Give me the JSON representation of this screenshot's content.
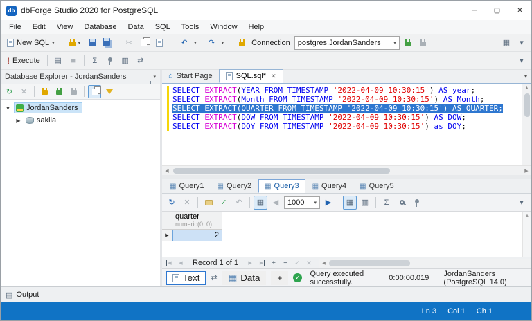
{
  "colors": {
    "accent": "#1073c5",
    "selection": "#2e77d0",
    "keyword": "#0000f0",
    "function": "#d600d6",
    "string": "#e00000",
    "changebar": "#f5d60a",
    "success": "#2ea44f"
  },
  "icons": {
    "minimize": "─",
    "maximize": "▢",
    "close": "✕",
    "caret_down": "▾",
    "overflow": "▾",
    "refresh": "↻",
    "undo": "↶",
    "redo": "↷",
    "cut": "✂",
    "check": "✓",
    "cross": "✕",
    "play_right": "▶",
    "play_left": "◀",
    "tri_up": "▲",
    "tri_down": "▼",
    "grid": "▦",
    "card": "▥",
    "swap": "⇄",
    "home": "⌂",
    "row_marker": "▶",
    "plus": "+",
    "minus": "−",
    "stop": "■",
    "sigma": "Σ",
    "panel": "▤",
    "exclaim": "!",
    "logo_text": "db"
  },
  "window": {
    "title": "dbForge Studio 2020 for PostgreSQL"
  },
  "menu": {
    "items": [
      "File",
      "Edit",
      "View",
      "Database",
      "Data",
      "SQL",
      "Tools",
      "Window",
      "Help"
    ]
  },
  "toolbar_standard": {
    "new_sql_label": "New SQL",
    "connection_label": "Connection",
    "connection_value": "postgres.JordanSanders"
  },
  "toolbar_execute": {
    "execute_label": "Execute"
  },
  "explorer": {
    "title": "Database Explorer - JordanSanders",
    "nodes": [
      {
        "label": "JordanSanders"
      },
      {
        "label": "sakila"
      }
    ]
  },
  "doc_tabs": {
    "start_page": "Start Page",
    "sql_doc": "SQL.sql*"
  },
  "editor": {
    "lines": [
      {
        "selected": false,
        "tokens": [
          {
            "t": "SELECT ",
            "c": "kw"
          },
          {
            "t": "EXTRACT",
            "c": "fn"
          },
          {
            "t": "(",
            "c": "pl"
          },
          {
            "t": "YEAR",
            "c": "kw"
          },
          {
            "t": " FROM TIMESTAMP ",
            "c": "kw"
          },
          {
            "t": "'2022-04-09 10:30:15'",
            "c": "str"
          },
          {
            "t": ")",
            "c": "pl"
          },
          {
            "t": " ",
            "c": "pl"
          },
          {
            "t": "AS",
            "c": "kw"
          },
          {
            "t": " ",
            "c": "pl"
          },
          {
            "t": "year",
            "c": "kw"
          },
          {
            "t": ";",
            "c": "pl"
          }
        ]
      },
      {
        "selected": false,
        "tokens": [
          {
            "t": "SELECT ",
            "c": "kw"
          },
          {
            "t": "EXTRACT",
            "c": "fn"
          },
          {
            "t": "(",
            "c": "pl"
          },
          {
            "t": "Month",
            "c": "kw"
          },
          {
            "t": " FROM TIMESTAMP ",
            "c": "kw"
          },
          {
            "t": "'2022-04-09 10:30:15'",
            "c": "str"
          },
          {
            "t": ")",
            "c": "pl"
          },
          {
            "t": " ",
            "c": "pl"
          },
          {
            "t": "AS",
            "c": "kw"
          },
          {
            "t": " ",
            "c": "pl"
          },
          {
            "t": "Month",
            "c": "kw"
          },
          {
            "t": ";",
            "c": "pl"
          }
        ]
      },
      {
        "selected": true,
        "tokens": [
          {
            "t": "SELECT ",
            "c": "kw"
          },
          {
            "t": "EXTRACT",
            "c": "fn"
          },
          {
            "t": "(",
            "c": "pl"
          },
          {
            "t": "QUARTER",
            "c": "kw"
          },
          {
            "t": " FROM TIMESTAMP ",
            "c": "kw"
          },
          {
            "t": "'2022-04-09 10:30:15'",
            "c": "str"
          },
          {
            "t": ")",
            "c": "pl"
          },
          {
            "t": " ",
            "c": "pl"
          },
          {
            "t": "AS",
            "c": "kw"
          },
          {
            "t": " ",
            "c": "pl"
          },
          {
            "t": "QUARTER",
            "c": "kw"
          },
          {
            "t": ";",
            "c": "pl"
          }
        ]
      },
      {
        "selected": false,
        "tokens": [
          {
            "t": "SELECT ",
            "c": "kw"
          },
          {
            "t": "EXTRACT",
            "c": "fn"
          },
          {
            "t": "(",
            "c": "pl"
          },
          {
            "t": "DOW",
            "c": "kw"
          },
          {
            "t": " FROM TIMESTAMP ",
            "c": "kw"
          },
          {
            "t": "'2022-04-09 10:30:15'",
            "c": "str"
          },
          {
            "t": ")",
            "c": "pl"
          },
          {
            "t": " ",
            "c": "pl"
          },
          {
            "t": "AS",
            "c": "kw"
          },
          {
            "t": " ",
            "c": "pl"
          },
          {
            "t": "DOW",
            "c": "kw"
          },
          {
            "t": ";",
            "c": "pl"
          }
        ]
      },
      {
        "selected": false,
        "tokens": [
          {
            "t": "SELECT ",
            "c": "kw"
          },
          {
            "t": "EXTRACT",
            "c": "fn"
          },
          {
            "t": "(",
            "c": "pl"
          },
          {
            "t": "DOY",
            "c": "kw"
          },
          {
            "t": " FROM TIMESTAMP ",
            "c": "kw"
          },
          {
            "t": "'2022-04-09 10:30:15'",
            "c": "str"
          },
          {
            "t": ")",
            "c": "pl"
          },
          {
            "t": " ",
            "c": "pl"
          },
          {
            "t": "as",
            "c": "kw"
          },
          {
            "t": " ",
            "c": "pl"
          },
          {
            "t": "DOY",
            "c": "kw"
          },
          {
            "t": ";",
            "c": "pl"
          }
        ]
      }
    ]
  },
  "query_tabs": [
    "Query1",
    "Query2",
    "Query3",
    "Query4",
    "Query5"
  ],
  "results_toolbar": {
    "page_size": "1000"
  },
  "grid": {
    "column": {
      "name": "quarter",
      "type": "numeric(0, 0)"
    },
    "rows": [
      {
        "value": "2"
      }
    ]
  },
  "record_nav": {
    "label": "Record 1 of 1"
  },
  "view_tabs": {
    "text": "Text",
    "data": "Data",
    "add": "+"
  },
  "exec_status": {
    "message": "Query executed successfully.",
    "duration": "0:00:00.019",
    "connection": "JordanSanders (PostgreSQL 14.0)"
  },
  "output_panel": {
    "label": "Output"
  },
  "status_bar": {
    "line": "Ln 3",
    "col": "Col 1",
    "ch": "Ch 1"
  }
}
